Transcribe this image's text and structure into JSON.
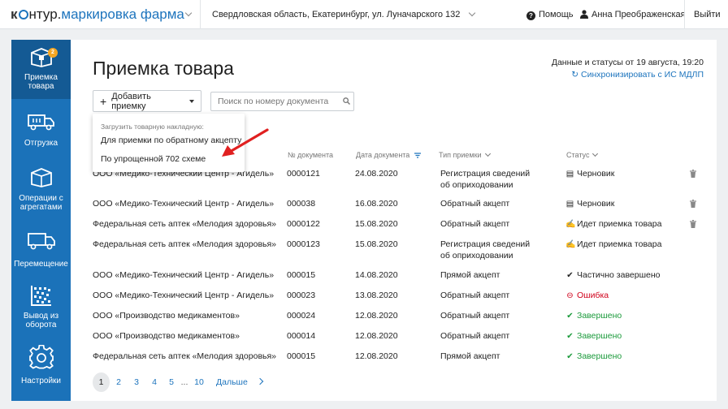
{
  "header": {
    "logo_kontur": "к",
    "logo_rest": "нтур.",
    "logo_product": "маркировка фарма",
    "location": "Свердловская область, Екатеринбург, ул. Луначарского 132",
    "help_label": "Помощь",
    "user_name": "Анна Преображенская",
    "logout_label": "Выйти"
  },
  "sidebar": {
    "items": [
      {
        "label": "Приемка товара",
        "badge": "2",
        "icon": "box-icon"
      },
      {
        "label": "Отгрузка",
        "icon": "truck-icon"
      },
      {
        "label": "Операции с агрегатами",
        "icon": "package-icon"
      },
      {
        "label": "Перемещение",
        "icon": "truck-move-icon"
      },
      {
        "label": "Вывод из оборота",
        "icon": "datamatrix-icon"
      },
      {
        "label": "Настройки",
        "icon": "gear-icon"
      }
    ]
  },
  "main": {
    "title": "Приемка товара",
    "sync_date": "Данные и статусы от 19 августа, 19:20",
    "sync_link": "Синхронизировать с ИС МДЛП",
    "add_button": "Добавить приемку",
    "search_placeholder": "Поиск по номеру документа",
    "dropdown": {
      "caption": "Загрузить товарную накладную:",
      "items": [
        "Для приемки по обратному акцепту",
        "По упрощенной 702 схеме"
      ]
    },
    "columns": {
      "doc_number": "№ документа",
      "doc_date": "Дата документа",
      "type": "Тип приемки",
      "status": "Статус"
    },
    "rows": [
      {
        "supplier": "ООО «Медико-Технический Центр - Агидель»",
        "number": "0000121",
        "date": "24.08.2020",
        "type1": "Регистрация сведений",
        "type2": "об оприходовании",
        "status": "Черновик",
        "status_kind": "draft",
        "deletable": true
      },
      {
        "supplier": "ООО «Медико-Технический Центр - Агидель»",
        "number": "000038",
        "date": "16.08.2020",
        "type1": "Обратный акцепт",
        "type2": "",
        "status": "Черновик",
        "status_kind": "draft",
        "deletable": true
      },
      {
        "supplier": "Федеральная сеть аптек «Мелодия здоровья»",
        "number": "0000122",
        "date": "15.08.2020",
        "type1": "Обратный акцепт",
        "type2": "",
        "status": "Идет приемка товара",
        "status_kind": "progress",
        "deletable": true
      },
      {
        "supplier": "Федеральная сеть аптек «Мелодия здоровья»",
        "number": "0000123",
        "date": "15.08.2020",
        "type1": "Регистрация сведений",
        "type2": "об оприходовании",
        "status": "Идет приемка товара",
        "status_kind": "progress",
        "deletable": false
      },
      {
        "supplier": "ООО «Медико-Технический Центр - Агидель»",
        "number": "000015",
        "date": "14.08.2020",
        "type1": "Прямой акцепт",
        "type2": "",
        "status": "Частично завершено",
        "status_kind": "partial",
        "deletable": false
      },
      {
        "supplier": "ООО «Медико-Технический Центр - Агидель»",
        "number": "000023",
        "date": "13.08.2020",
        "type1": "Обратный акцепт",
        "type2": "",
        "status": "Ошибка",
        "status_kind": "error",
        "deletable": false
      },
      {
        "supplier": "ООО «Производство медикаментов»",
        "number": "000024",
        "date": "12.08.2020",
        "type1": "Обратный акцепт",
        "type2": "",
        "status": "Завершено",
        "status_kind": "done",
        "deletable": false
      },
      {
        "supplier": "ООО «Производство медикаментов»",
        "number": "000014",
        "date": "12.08.2020",
        "type1": "Обратный акцепт",
        "type2": "",
        "status": "Завершено",
        "status_kind": "done",
        "deletable": false
      },
      {
        "supplier": "Федеральная сеть аптек «Мелодия здоровья»",
        "number": "000015",
        "date": "12.08.2020",
        "type1": "Прямой акцепт",
        "type2": "",
        "status": "Завершено",
        "status_kind": "done",
        "deletable": false
      }
    ],
    "pagination": {
      "pages": [
        "1",
        "2",
        "3",
        "4",
        "5",
        "...",
        "10"
      ],
      "current": "1",
      "next_label": "Дальше"
    }
  },
  "colors": {
    "sidebar": "#1b72b9",
    "sidebar_active": "#145a94",
    "link": "#1d74bd",
    "success": "#1b9a3b",
    "error": "#d0021b",
    "badge": "#f5a623",
    "annotation_arrow": "#e02020"
  }
}
